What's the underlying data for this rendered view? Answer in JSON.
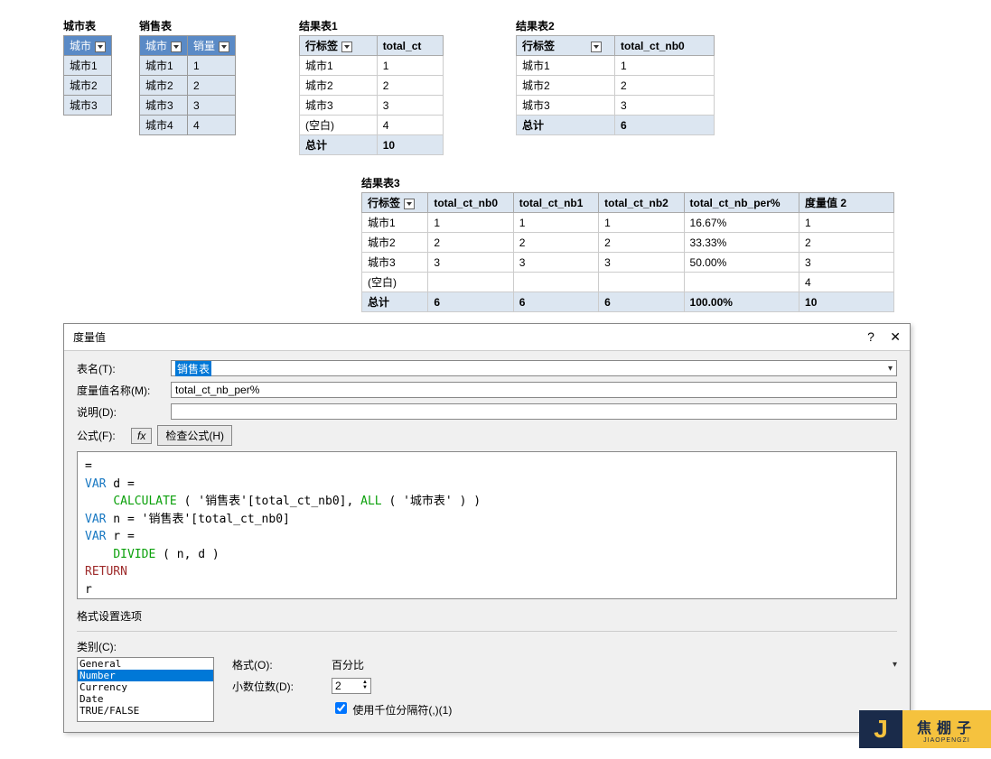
{
  "tables_top": {
    "city": {
      "title": "城市表",
      "header": "城市",
      "rows": [
        "城市1",
        "城市2",
        "城市3"
      ]
    },
    "sales": {
      "title": "销售表",
      "headers": [
        "城市",
        "销量"
      ],
      "rows": [
        {
          "c": "城市1",
          "v": "1"
        },
        {
          "c": "城市2",
          "v": "2"
        },
        {
          "c": "城市3",
          "v": "3"
        },
        {
          "c": "城市4",
          "v": "4"
        }
      ]
    },
    "result1": {
      "title": "结果表1",
      "headers": [
        "行标签",
        "total_ct"
      ],
      "rows": [
        {
          "l": "城市1",
          "v": "1"
        },
        {
          "l": "城市2",
          "v": "2"
        },
        {
          "l": "城市3",
          "v": "3"
        },
        {
          "l": "(空白)",
          "v": "4"
        }
      ],
      "total": {
        "l": "总计",
        "v": "10"
      }
    },
    "result2": {
      "title": "结果表2",
      "headers": [
        "行标签",
        "total_ct_nb0"
      ],
      "rows": [
        {
          "l": "城市1",
          "v": "1"
        },
        {
          "l": "城市2",
          "v": "2"
        },
        {
          "l": "城市3",
          "v": "3"
        }
      ],
      "total": {
        "l": "总计",
        "v": "6"
      }
    },
    "result3": {
      "title": "结果表3",
      "headers": [
        "行标签",
        "total_ct_nb0",
        "total_ct_nb1",
        "total_ct_nb2",
        "total_ct_nb_per%",
        "度量值 2"
      ],
      "rows": [
        {
          "l": "城市1",
          "c0": "1",
          "c1": "1",
          "c2": "1",
          "p": "16.67%",
          "m": "1"
        },
        {
          "l": "城市2",
          "c0": "2",
          "c1": "2",
          "c2": "2",
          "p": "33.33%",
          "m": "2"
        },
        {
          "l": "城市3",
          "c0": "3",
          "c1": "3",
          "c2": "3",
          "p": "50.00%",
          "m": "3"
        },
        {
          "l": "(空白)",
          "c0": "",
          "c1": "",
          "c2": "",
          "p": "",
          "m": "4"
        }
      ],
      "total": {
        "l": "总计",
        "c0": "6",
        "c1": "6",
        "c2": "6",
        "p": "100.00%",
        "m": "10"
      }
    }
  },
  "dialog": {
    "title": "度量值",
    "help": "?",
    "close": "✕",
    "table_label": "表名(T):",
    "table_value": "销售表",
    "name_label": "度量值名称(M):",
    "name_value": "total_ct_nb_per%",
    "desc_label": "说明(D):",
    "desc_value": "",
    "formula_label": "公式(F):",
    "fx": "fx",
    "check_formula": "检查公式(H)",
    "formula_lines": {
      "l1_eq": "=",
      "l2_var": "VAR",
      "l2_name": " d =",
      "l3_calc": "CALCULATE",
      "l3_open": " ( ",
      "l3_ref": "'销售表'[total_ct_nb0]",
      "l3_mid": ", ",
      "l3_all": "ALL",
      "l3_allarg": " ( '城市表' ) )",
      "l4_var": "VAR",
      "l4_rest": " n = '销售表'[total_ct_nb0]",
      "l5_var": "VAR",
      "l5_name": " r =",
      "l6_div": "DIVIDE",
      "l6_args": " ( n, d )",
      "l7_ret": "RETURN",
      "l8": "    r"
    },
    "format_section": "格式设置选项",
    "category_label": "类别(C):",
    "categories": [
      "General",
      "Number",
      "Currency",
      "Date",
      "TRUE/FALSE"
    ],
    "category_selected": "Number",
    "format_label": "格式(O):",
    "format_value": "百分比",
    "decimal_label": "小数位数(D):",
    "decimal_value": "2",
    "thousand_label": "使用千位分隔符(,)(1)"
  },
  "brand": {
    "j": "J",
    "cn": "焦棚子",
    "en": "JIAOPENGZI"
  }
}
